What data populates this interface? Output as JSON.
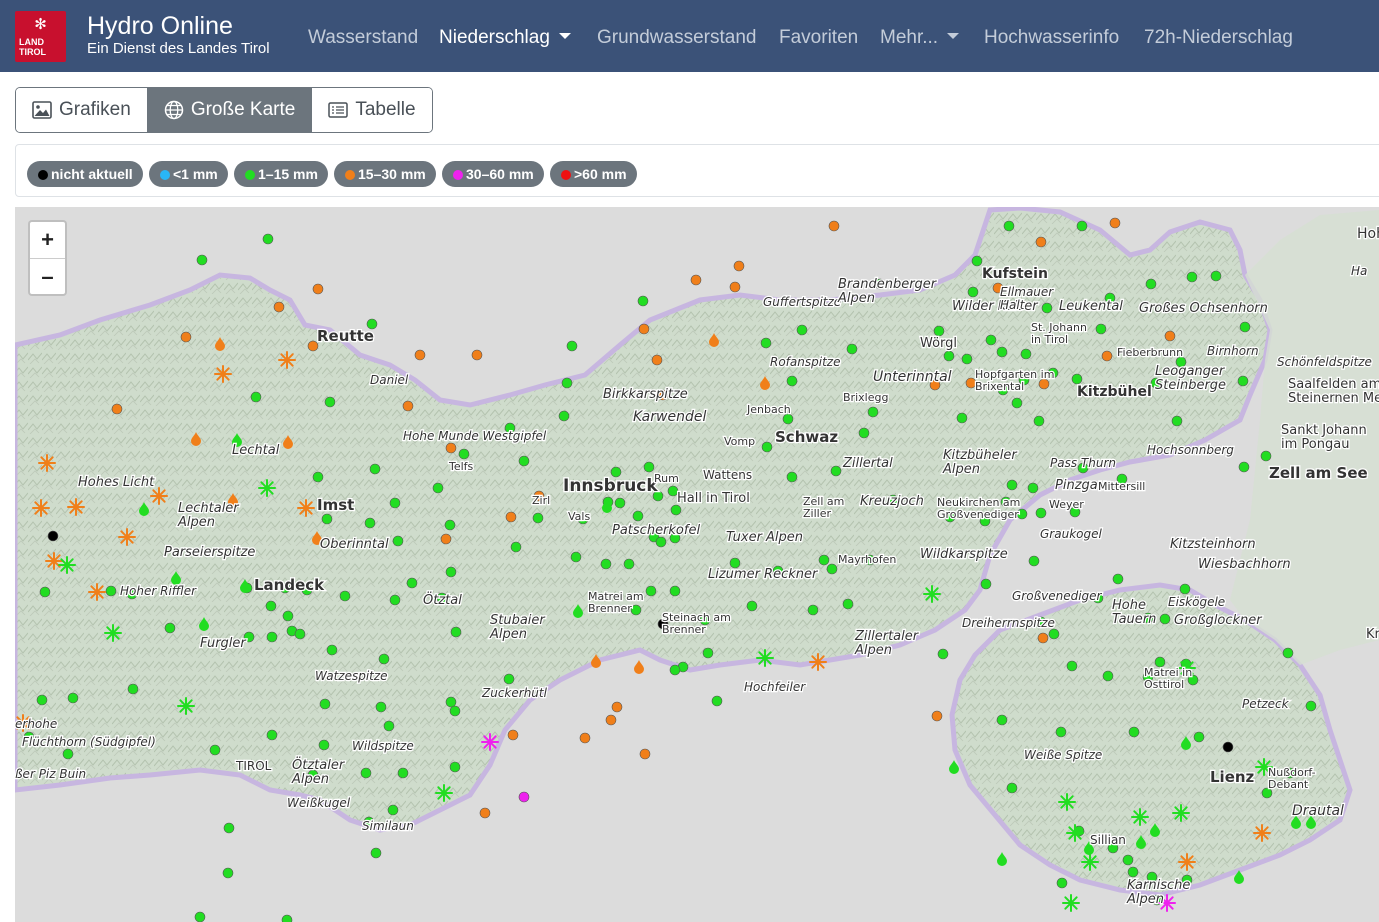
{
  "navbar": {
    "logo_text_line1": "LAND",
    "logo_text_line2": "TIROL",
    "title": "Hydro Online",
    "subtitle": "Ein Dienst des Landes Tirol",
    "items": [
      {
        "label": "Wasserstand",
        "active": false,
        "dropdown": false
      },
      {
        "label": "Niederschlag",
        "active": true,
        "dropdown": true
      },
      {
        "label": "Grundwasserstand",
        "active": false,
        "dropdown": false
      },
      {
        "label": "Favoriten",
        "active": false,
        "dropdown": false
      },
      {
        "label": "Mehr...",
        "active": false,
        "dropdown": true
      },
      {
        "label": "Hochwasserinfo",
        "active": false,
        "dropdown": false
      },
      {
        "label": "72h-Niederschlag",
        "active": false,
        "dropdown": false
      }
    ]
  },
  "view_toggle": {
    "buttons": [
      {
        "label": "Grafiken",
        "icon": "image-icon",
        "active": false
      },
      {
        "label": "Große Karte",
        "icon": "globe-icon",
        "active": true
      },
      {
        "label": "Tabelle",
        "icon": "list-icon",
        "active": false
      }
    ]
  },
  "legend": {
    "items": [
      {
        "label": "nicht aktuell",
        "color": "#000000"
      },
      {
        "label": "<1 mm",
        "color": "#29b6f6"
      },
      {
        "label": "1–15 mm",
        "color": "#22dd22"
      },
      {
        "label": "15–30 mm",
        "color": "#f07f1a"
      },
      {
        "label": "30–60 mm",
        "color": "#ee22ee"
      },
      {
        "label": ">60 mm",
        "color": "#ee1111"
      }
    ]
  },
  "map": {
    "zoom_in_label": "+",
    "zoom_out_label": "–",
    "place_labels": [
      "Reutte",
      "Daniel",
      "Lechtal",
      "Hohes Licht",
      "Lechtaler Alpen",
      "Imst",
      "Parseierspitze",
      "Oberinntal",
      "Landeck",
      "Hoher Riffler",
      "Furgler",
      "Watzespitze",
      "Ötztal",
      "Stubaier Alpen",
      "Zuckerhütl",
      "Wildspitze",
      "Ötztaler Alpen",
      "Weißkugel",
      "Similaun",
      "Hohe Munde Westgipfel",
      "Telfs",
      "Zirl",
      "Vals",
      "Innsbruck",
      "Rum",
      "Hall in Tirol",
      "Wattens",
      "Patscherkofel",
      "Matrei am Brenner",
      "Steinach am Brenner",
      "Birkkarspitze",
      "Karwendel",
      "Jenbach",
      "Vomp",
      "Schwaz",
      "Rofanspitze",
      "Guffertspitze",
      "Brandenberger Alpen",
      "Kufstein",
      "Wilder Kaiser",
      "Ellmauer Halt",
      "Leukental",
      "Großes Ochsenhorn",
      "St. Johann in Tirol",
      "Fieberbrunn",
      "Birnhorn",
      "Wörgl",
      "Unterinntal",
      "Brixlegg",
      "Hopfgarten im Brixental",
      "Leoganger Steinberge",
      "Kitzbühel",
      "Kitzbüheler Alpen",
      "Pass Thurn",
      "Hochsonnberg",
      "Zillertal",
      "Zell am Ziller",
      "Kreuzjoch",
      "Neukirchen am Großvenediger",
      "Pinzgau",
      "Mittersill",
      "Weyer",
      "Tuxer Alpen",
      "Lizumer Reckner",
      "Mayrhofen",
      "Wildkarspitze",
      "Graukogel",
      "Kitzsteinhorn",
      "Wiesbachhorn",
      "Großvenediger",
      "Hohe Tauern",
      "Eiskögele",
      "Großglockner",
      "Dreiherrnspitze",
      "Zillertaler Alpen",
      "Hochfeiler",
      "Matrei in Osttirol",
      "Petzeck",
      "Weiße Spitze",
      "Lienz",
      "Nußdorf-Debant",
      "Drautal",
      "Sillian",
      "Karnische Alpen",
      "Zell am See",
      "Schönfeldspitze",
      "Saalfelden am Steinernen Meer",
      "Sankt Johann im Pongau",
      "Hohe",
      "Ha",
      "Kr",
      "erhohe",
      "Flüchthorn (Südgipfel)",
      "ßer Piz Buin",
      "TIROL"
    ]
  }
}
